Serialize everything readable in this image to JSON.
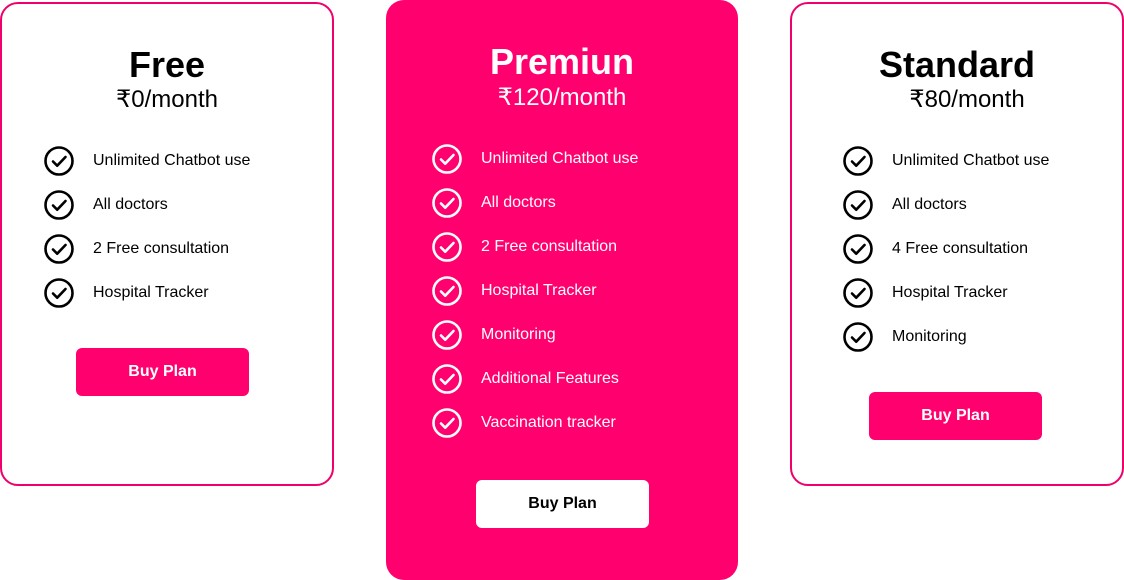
{
  "colors": {
    "accent": "#ff006e",
    "accent_border": "#f0006b",
    "on_accent": "#ffffff",
    "text": "#000000"
  },
  "icons": {
    "feature": "check-circle-icon"
  },
  "plans": [
    {
      "name": "Free",
      "price": "₹0/month",
      "features": [
        "Unlimited Chatbot use",
        "All doctors",
        "2 Free consultation",
        "Hospital Tracker"
      ],
      "button_label": "Buy Plan"
    },
    {
      "name": "Premiun",
      "price": "₹120/month",
      "features": [
        "Unlimited Chatbot use",
        "All doctors",
        "2 Free consultation",
        "Hospital Tracker",
        "Monitoring",
        "Additional Features",
        "Vaccination tracker"
      ],
      "button_label": "Buy Plan"
    },
    {
      "name": "Standard",
      "price": "₹80/month",
      "features": [
        "Unlimited Chatbot use",
        "All doctors",
        "4 Free consultation",
        "Hospital Tracker",
        "Monitoring"
      ],
      "button_label": "Buy Plan"
    }
  ]
}
